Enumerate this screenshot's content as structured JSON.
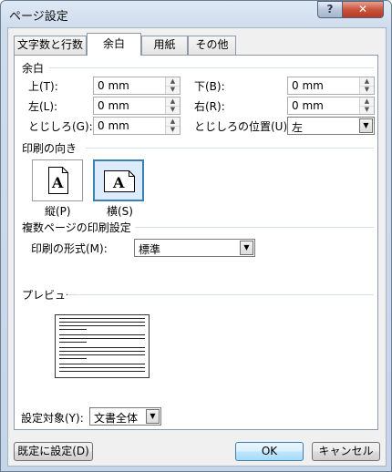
{
  "window": {
    "title": "ページ設定",
    "help": "?",
    "close": "✕"
  },
  "tabs": [
    {
      "label": "文字数と行数",
      "active": false
    },
    {
      "label": "余白",
      "active": true
    },
    {
      "label": "用紙",
      "active": false
    },
    {
      "label": "その他",
      "active": false
    }
  ],
  "margins": {
    "group": "余白",
    "top_label": "上(T):",
    "top_value": "0 mm",
    "bottom_label": "下(B):",
    "bottom_value": "0 mm",
    "left_label": "左(L):",
    "left_value": "0 mm",
    "right_label": "右(R):",
    "right_value": "0 mm",
    "gutter_label": "とじしろ(G):",
    "gutter_value": "0 mm",
    "gutter_pos_label": "とじしろの位置(U):",
    "gutter_pos_value": "左"
  },
  "orientation": {
    "group": "印刷の向き",
    "portrait_label": "縦(P)",
    "landscape_label": "横(S)",
    "icon_letter": "A",
    "selected": "landscape"
  },
  "pages": {
    "group": "複数ページの印刷設定",
    "format_label": "印刷の形式(M):",
    "format_value": "標準"
  },
  "preview": {
    "group": "プレビュー"
  },
  "apply": {
    "label": "設定対象(Y):",
    "value": "文書全体"
  },
  "buttons": {
    "default": "既定に設定(D)",
    "ok": "OK",
    "cancel": "キャンセル"
  },
  "colors": {
    "accent": "#3c7fb1",
    "close": "#c8543c"
  }
}
